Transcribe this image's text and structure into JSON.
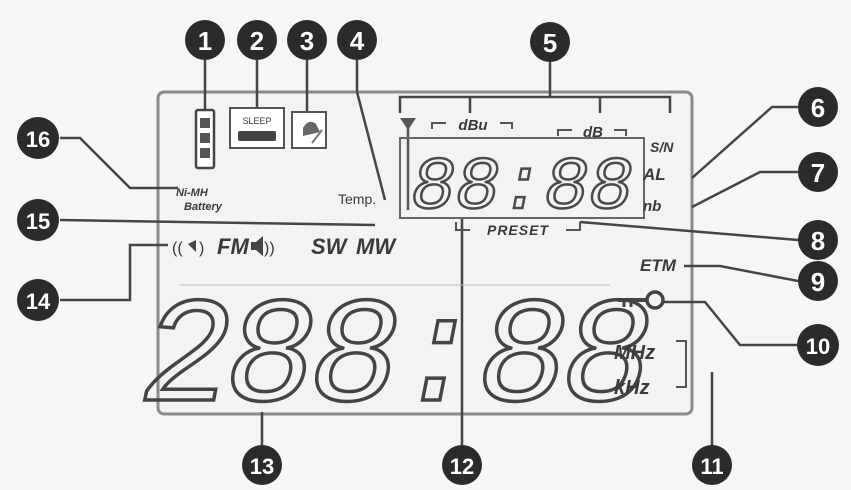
{
  "callouts": {
    "c1": "1",
    "c2": "2",
    "c3": "3",
    "c4": "4",
    "c5": "5",
    "c6": "6",
    "c7": "7",
    "c8": "8",
    "c9": "9",
    "c10": "10",
    "c11": "11",
    "c12": "12",
    "c13": "13",
    "c14": "14",
    "c15": "15",
    "c16": "16"
  },
  "lcd": {
    "sleep": "SLEEP",
    "dbu": "dBu",
    "db": "dB",
    "sn": "S/N",
    "al": "AL",
    "nb": "nb",
    "temp": "Temp.",
    "preset": "PRESET",
    "battery_type": "Ni-MH",
    "battery": "Battery",
    "fm": "FM",
    "sw": "SW",
    "mw": "MW",
    "etm": "ETM",
    "mhz": "MHz",
    "khz": "kHz",
    "small_digits": "88:88",
    "large_digits": "288:88"
  },
  "colors": {
    "callout_fill": "#2b2b2b",
    "line": "#454545",
    "panel_border": "#8a8a8a"
  },
  "icons": [
    "battery-level-icon",
    "sleep-timer-icon",
    "alarm-bell-icon",
    "signal-antenna-icon",
    "speaker-icon",
    "key-lock-icon"
  ]
}
